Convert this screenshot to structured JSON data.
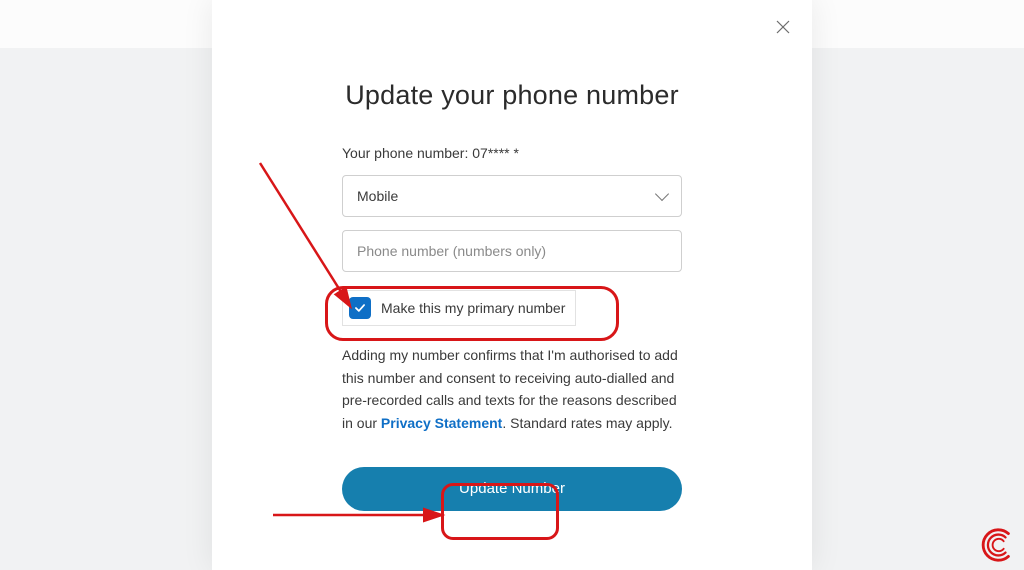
{
  "modal": {
    "title": "Update your phone number",
    "masked_label": "Your phone number: 07**** *",
    "phone_type": {
      "selected": "Mobile"
    },
    "phone_input": {
      "value": "",
      "placeholder": "Phone number (numbers only)"
    },
    "primary_checkbox": {
      "checked": true,
      "label": "Make this my primary number"
    },
    "disclaimer": {
      "pre": "Adding my number confirms that I'm authorised to add this number and consent to receiving auto-dialled and pre-recorded calls and texts for the reasons described in our ",
      "link": "Privacy Statement",
      "post": ". Standard rates may apply."
    },
    "submit_label": "Update Number"
  }
}
